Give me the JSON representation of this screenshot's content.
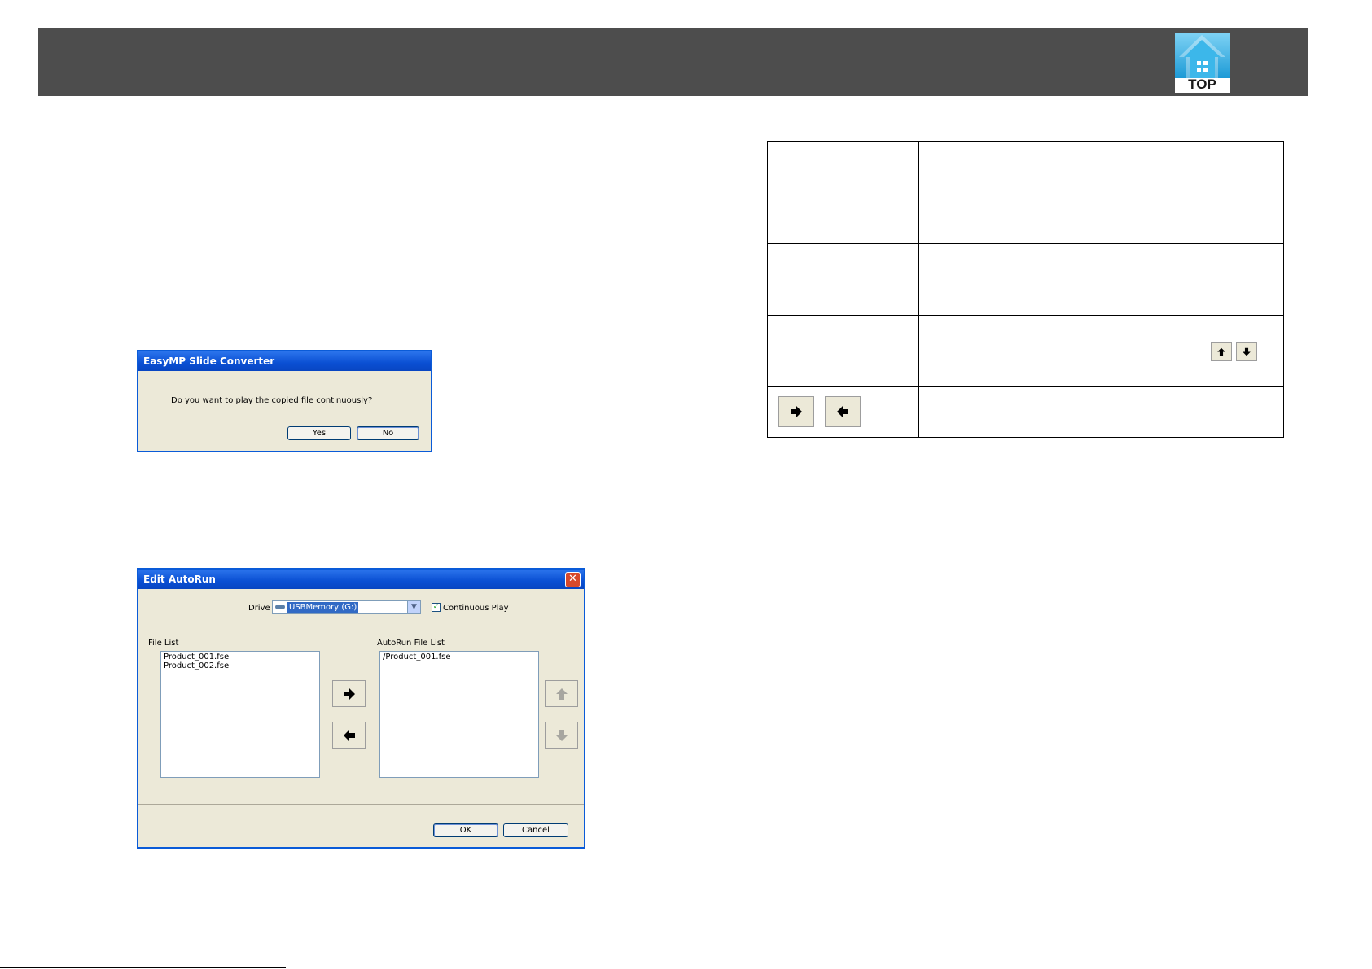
{
  "header": {
    "logo_text": "TOP"
  },
  "dialog_continuous": {
    "title": "EasyMP Slide Converter",
    "message": "Do you want to play the copied file continuously?",
    "yes_label": "Yes",
    "no_label": "No"
  },
  "dialog_autorun": {
    "title": "Edit AutoRun",
    "drive_label": "Drive",
    "drive_value": "USBMemory (G:)",
    "continuous_play_label": "Continuous Play",
    "continuous_play_checked": true,
    "file_list_label": "File List",
    "file_list": [
      "Product_001.fse",
      "Product_002.fse"
    ],
    "autorun_list_label": "AutoRun File List",
    "autorun_list": [
      "/Product_001.fse"
    ],
    "ok_label": "OK",
    "cancel_label": "Cancel"
  },
  "colors": {
    "header": "#4d4d4d",
    "xp_title": "#0a4fd3",
    "xp_body": "#ece9d8",
    "logo_blue": "#29a9e0"
  }
}
